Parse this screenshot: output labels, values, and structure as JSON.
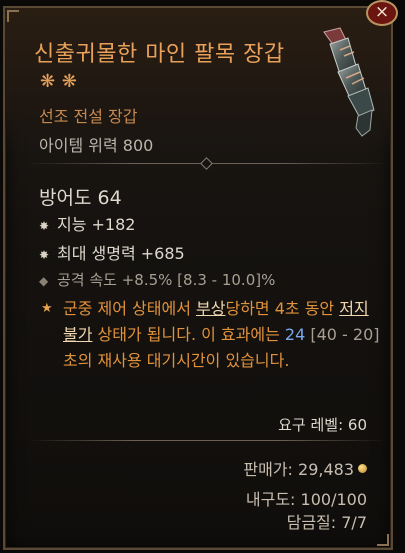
{
  "tooltip": {
    "close_glyph": "×",
    "title": "신출귀몰한 마인 팔목 장갑",
    "title_stars": "❋ ❋",
    "item_type": "선조 전설 장갑",
    "item_power": "아이템 위력 800",
    "armor": "방어도 64",
    "stats": [
      {
        "icon": "star-bullet-icon",
        "text": "지능 +182"
      },
      {
        "icon": "star-bullet-icon",
        "text": "최대 생명력 +685"
      },
      {
        "icon": "diamond-bullet-icon",
        "text": "공격 속도 +8.5% [8.3 - 10.0]%"
      }
    ],
    "aspect": {
      "icon": "legendary-star-icon",
      "t1": "군중 제어 상태에서 ",
      "u1": "부상",
      "t2": "당하면 4초 동안 ",
      "u2": "저지 불가",
      "t3": " 상태가 됩니다. 이 효과에는 ",
      "num": "24",
      "range": " [40 - 20]",
      "t4": "초의 재사용 대기시간이 있습니다."
    },
    "required_level": "요구 레벨: 60",
    "sell_value": "판매가: 29,483",
    "durability": "내구도: 100/100",
    "temper": "담금질: 7/7"
  },
  "colors": {
    "legendary": "#e8a15a",
    "aspect": "#e0923c",
    "value_blue": "#7aa8e8"
  }
}
